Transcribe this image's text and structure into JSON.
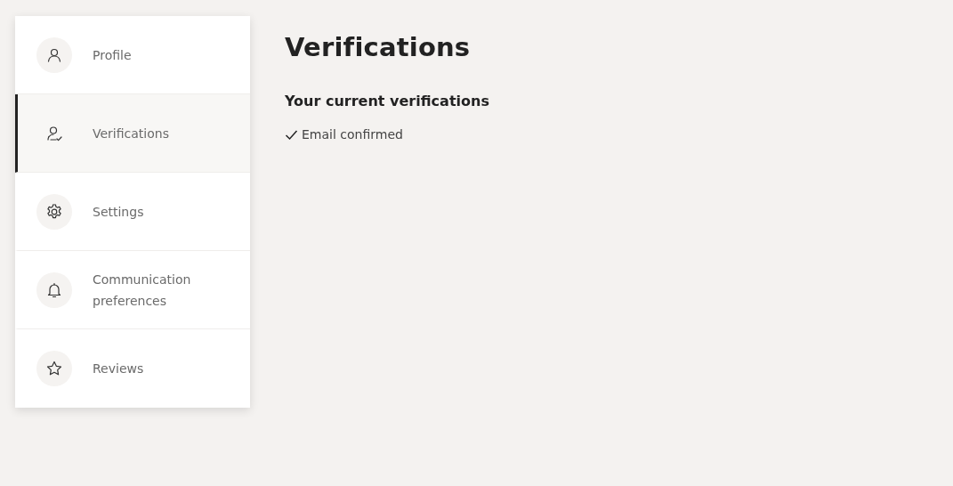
{
  "sidebar": {
    "items": [
      {
        "label": "Profile",
        "selected": false
      },
      {
        "label": "Verifications",
        "selected": true
      },
      {
        "label": "Settings",
        "selected": false
      },
      {
        "label": "Communication preferences",
        "selected": false
      },
      {
        "label": "Reviews",
        "selected": false
      }
    ]
  },
  "main": {
    "title": "Verifications",
    "subtitle": "Your current verifications",
    "verifications": [
      {
        "label": "Email confirmed",
        "verified": true
      }
    ]
  }
}
